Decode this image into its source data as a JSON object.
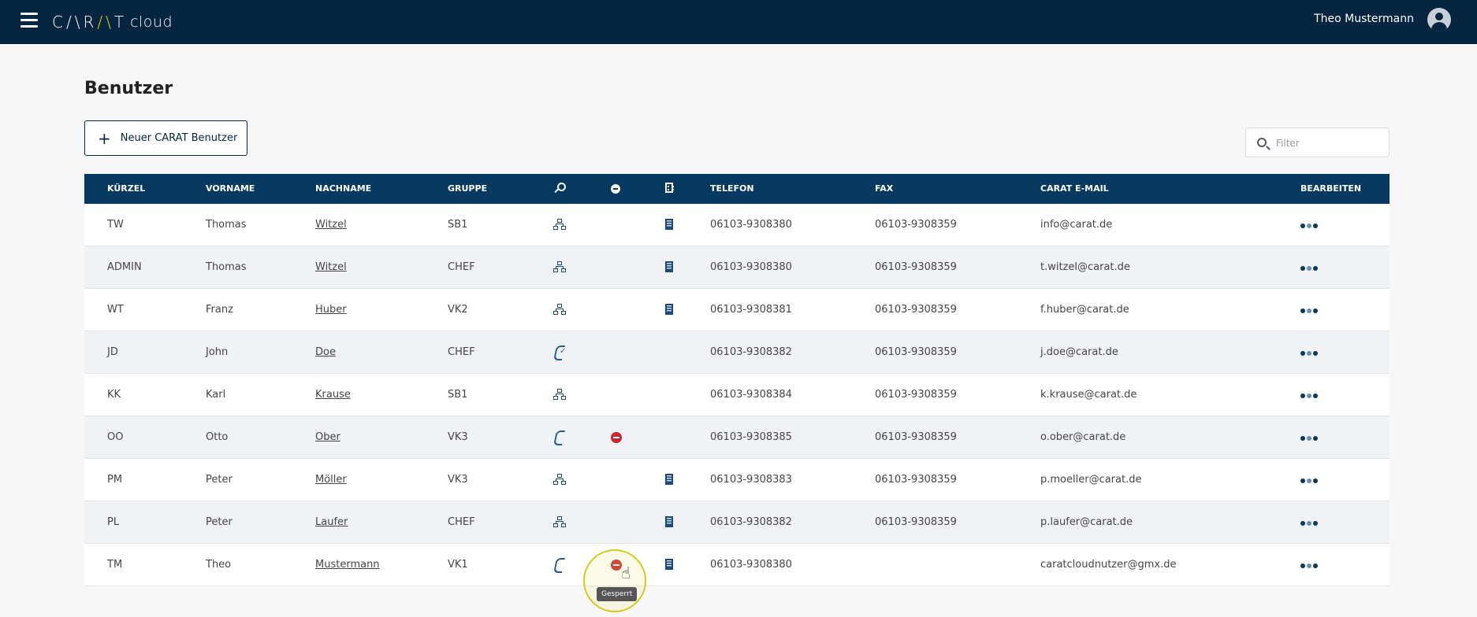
{
  "app": {
    "logo_main": "CARAT",
    "logo_sub": "cloud",
    "user_name": "Theo Mustermann"
  },
  "page": {
    "title": "Benutzer",
    "new_user_label": "Neuer CARAT Benutzer",
    "filter_placeholder": "Filter"
  },
  "table": {
    "headers": {
      "kuerzel": "KÜRZEL",
      "vorname": "VORNAME",
      "nachname": "NACHNAME",
      "gruppe": "GRUPPE",
      "telefon": "TELEFON",
      "fax": "FAX",
      "email": "CARAT E-MAIL",
      "bearbeiten": "BEARBEITEN"
    },
    "header_icons": [
      "key-icon",
      "blocked-icon",
      "branch-icon"
    ],
    "rows": [
      {
        "kuerzel": "TW",
        "vorname": "Thomas",
        "nachname": "Witzel",
        "gruppe": "SB1",
        "role_icon": "network-icon",
        "blocked": false,
        "branch": true,
        "telefon": "06103-9308380",
        "fax": "06103-9308359",
        "email": "info@carat.de"
      },
      {
        "kuerzel": "ADMIN",
        "vorname": "Thomas",
        "nachname": "Witzel",
        "gruppe": "CHEF",
        "role_icon": "network-icon",
        "blocked": false,
        "branch": true,
        "telefon": "06103-9308380",
        "fax": "06103-9308359",
        "email": "t.witzel@carat.de"
      },
      {
        "kuerzel": "WT",
        "vorname": "Franz",
        "nachname": "Huber",
        "gruppe": "VK2",
        "role_icon": "network-icon",
        "blocked": false,
        "branch": true,
        "telefon": "06103-9308381",
        "fax": "06103-9308359",
        "email": "f.huber@carat.de"
      },
      {
        "kuerzel": "JD",
        "vorname": "John",
        "nachname": "Doe",
        "gruppe": "CHEF",
        "role_icon": "phone-check-icon",
        "blocked": false,
        "branch": false,
        "telefon": "06103-9308382",
        "fax": "06103-9308359",
        "email": "j.doe@carat.de"
      },
      {
        "kuerzel": "KK",
        "vorname": "Karl",
        "nachname": "Krause",
        "gruppe": "SB1",
        "role_icon": "network-icon",
        "blocked": false,
        "branch": false,
        "telefon": "06103-9308384",
        "fax": "06103-9308359",
        "email": "k.krause@carat.de"
      },
      {
        "kuerzel": "OO",
        "vorname": "Otto",
        "nachname": "Ober",
        "gruppe": "VK3",
        "role_icon": "phone-icon",
        "blocked": true,
        "branch": false,
        "telefon": "06103-9308385",
        "fax": "06103-9308359",
        "email": "o.ober@carat.de"
      },
      {
        "kuerzel": "PM",
        "vorname": "Peter",
        "nachname": "Möller",
        "gruppe": "VK3",
        "role_icon": "network-icon",
        "blocked": false,
        "branch": true,
        "telefon": "06103-9308383",
        "fax": "06103-9308359",
        "email": "p.moeller@carat.de"
      },
      {
        "kuerzel": "PL",
        "vorname": "Peter",
        "nachname": "Laufer",
        "gruppe": "CHEF",
        "role_icon": "network-icon",
        "blocked": false,
        "branch": true,
        "telefon": "06103-9308382",
        "fax": "06103-9308359",
        "email": "p.laufer@carat.de"
      },
      {
        "kuerzel": "TM",
        "vorname": "Theo",
        "nachname": "Mustermann",
        "gruppe": "VK1",
        "role_icon": "phone-icon",
        "blocked": true,
        "branch": true,
        "telefon": "06103-9308380",
        "fax": "",
        "email": "caratcloudnutzer@gmx.de"
      }
    ]
  },
  "tooltip": {
    "text": "Gesperrt"
  },
  "colors": {
    "topbar": "#062540",
    "table_header": "#053960",
    "blocked": "#c8262e",
    "logo_accent": "#f0d800"
  }
}
